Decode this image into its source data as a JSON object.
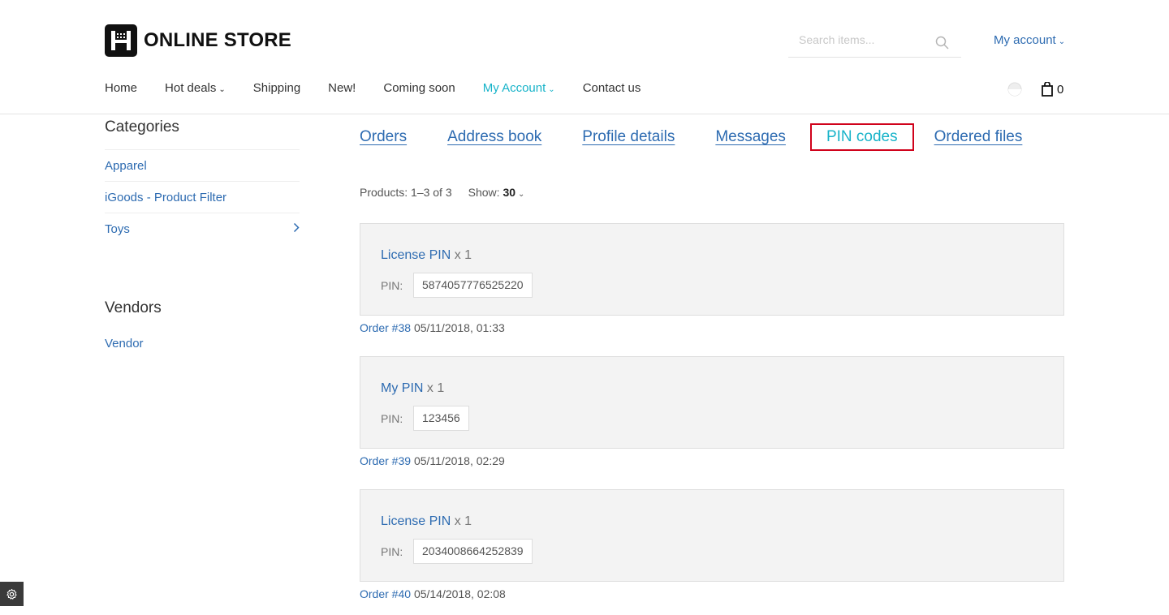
{
  "store": {
    "name": "ONLINE STORE"
  },
  "search": {
    "placeholder": "Search items..."
  },
  "account_menu": {
    "label": "My account"
  },
  "nav": [
    {
      "label": "Home",
      "dropdown": false
    },
    {
      "label": "Hot deals",
      "dropdown": true
    },
    {
      "label": "Shipping",
      "dropdown": false
    },
    {
      "label": "New!",
      "dropdown": false
    },
    {
      "label": "Coming soon",
      "dropdown": false
    },
    {
      "label": "My Account",
      "dropdown": true,
      "active": true
    },
    {
      "label": "Contact us",
      "dropdown": false
    }
  ],
  "cart": {
    "count": "0"
  },
  "sidebar": {
    "categories_heading": "Categories",
    "categories": [
      {
        "label": "Apparel"
      },
      {
        "label": "iGoods - Product Filter"
      },
      {
        "label": "Toys",
        "has_children": true
      }
    ],
    "vendors_heading": "Vendors",
    "vendors": [
      {
        "label": "Vendor"
      }
    ]
  },
  "tabs": [
    {
      "label": "Orders"
    },
    {
      "label": "Address book"
    },
    {
      "label": "Profile details"
    },
    {
      "label": "Messages"
    },
    {
      "label": "PIN codes",
      "selected": true
    },
    {
      "label": "Ordered files"
    }
  ],
  "pager": {
    "summary": "Products: 1–3 of 3",
    "show_label": "Show:",
    "show_value": "30"
  },
  "pins": [
    {
      "product": "License PIN",
      "qty": "x 1",
      "pin_label": "PIN:",
      "pin": "5874057776525220",
      "order": "Order #38",
      "date": "05/11/2018, 01:33"
    },
    {
      "product": "My PIN",
      "qty": "x 1",
      "pin_label": "PIN:",
      "pin": "123456",
      "order": "Order #39",
      "date": "05/11/2018, 02:29"
    },
    {
      "product": "License PIN",
      "qty": "x 1",
      "pin_label": "PIN:",
      "pin": "2034008664252839",
      "order": "Order #40",
      "date": "05/14/2018, 02:08"
    }
  ],
  "colors": {
    "link": "#2d6bb1",
    "accent": "#17b3c9",
    "highlight_border": "#d0021b",
    "card_bg": "#f3f3f3"
  }
}
